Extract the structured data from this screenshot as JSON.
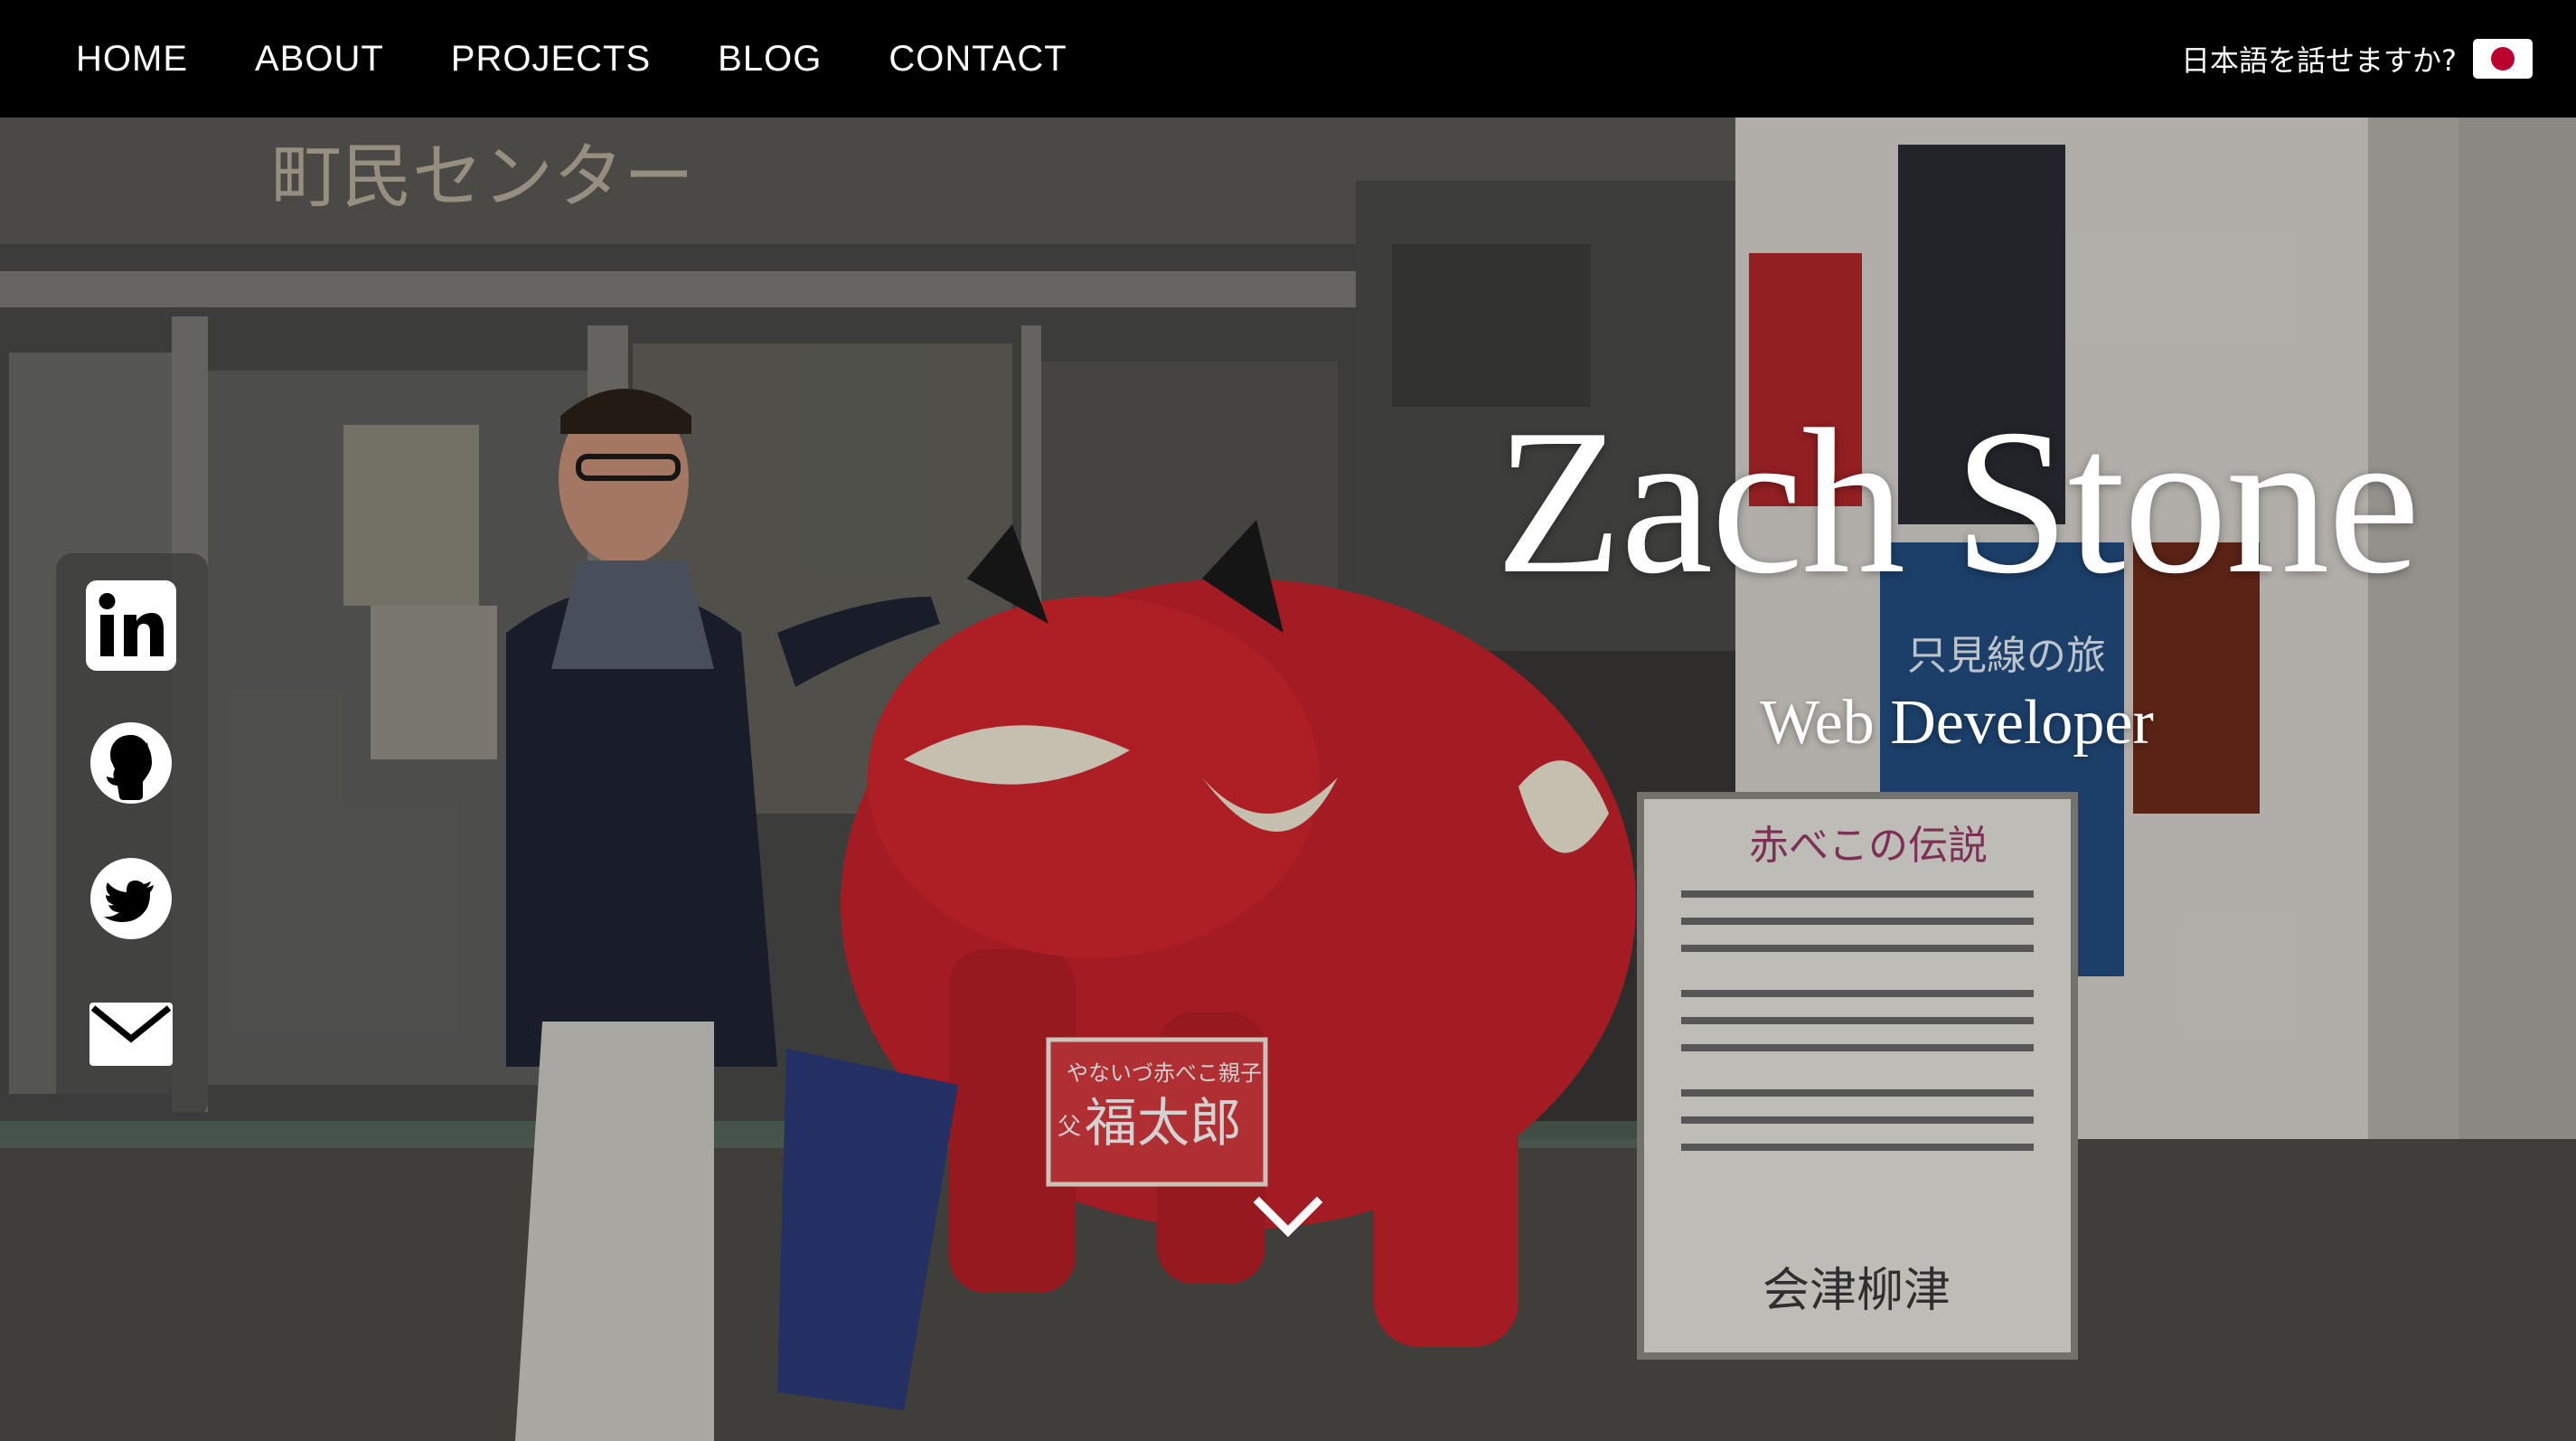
{
  "nav": {
    "links": [
      {
        "label": "HOME"
      },
      {
        "label": "ABOUT"
      },
      {
        "label": "PROJECTS"
      },
      {
        "label": "BLOG"
      },
      {
        "label": "CONTACT"
      }
    ],
    "language_prompt": "日本語を話せますか?",
    "language_flag_icon": "japan-flag-icon"
  },
  "hero": {
    "name": "Zach Stone",
    "role": "Web Developer",
    "scroll_icon": "chevron-down-icon"
  },
  "social": [
    {
      "icon": "linkedin-icon"
    },
    {
      "icon": "github-icon"
    },
    {
      "icon": "twitter-icon"
    },
    {
      "icon": "email-icon"
    }
  ],
  "photo_signs": {
    "building": "町民センター",
    "board_title": "赤べこの伝説",
    "board_footer": "会津柳津",
    "name_plate_top": "やないづ赤べこ親子",
    "name_plate_main": "福太郎",
    "name_plate_prefix": "父",
    "poster": "只見線の旅"
  },
  "colors": {
    "nav_bg": "#000000",
    "cow_red": "#d4262d",
    "flag_red": "#bc002d"
  }
}
